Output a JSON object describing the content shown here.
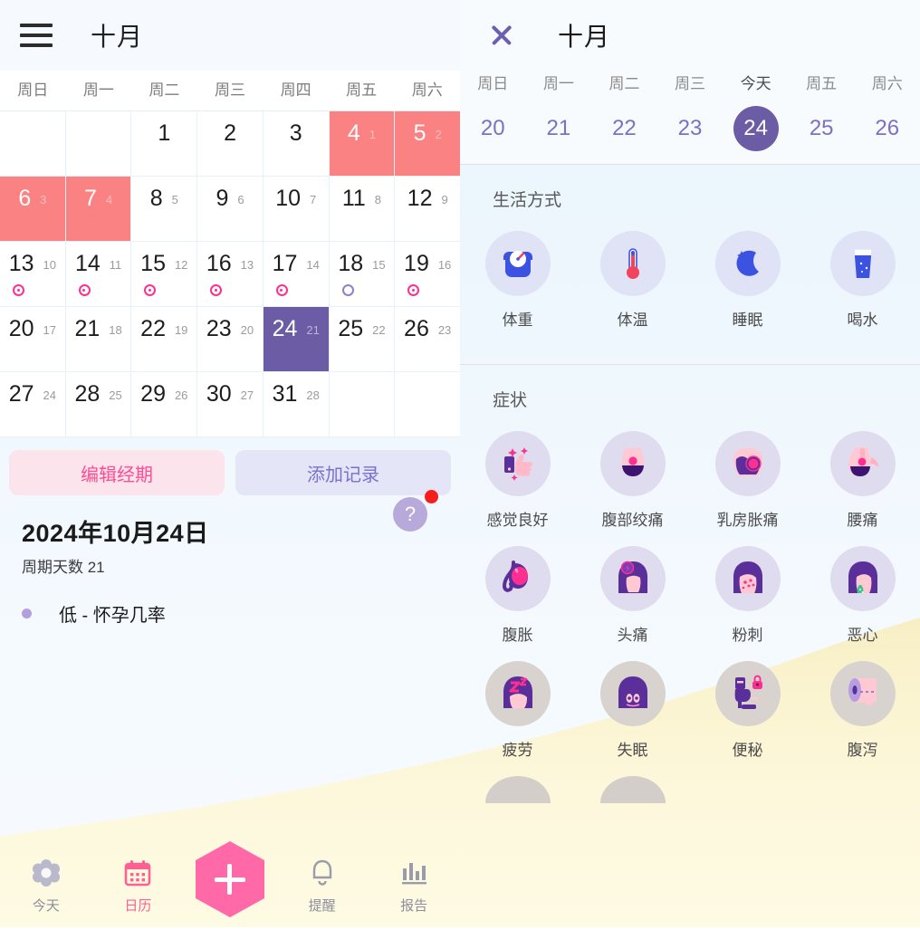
{
  "left": {
    "header": {
      "menu_icon": "hamburger-icon",
      "title": "十月"
    },
    "weekdays": [
      "周日",
      "周一",
      "周二",
      "周三",
      "周四",
      "周五",
      "周六"
    ],
    "calendar_rows": [
      [
        {
          "day": "",
          "sub": "",
          "type": "empty"
        },
        {
          "day": "",
          "sub": "",
          "type": "empty"
        },
        {
          "day": "1",
          "sub": "",
          "type": "normal"
        },
        {
          "day": "2",
          "sub": "",
          "type": "normal"
        },
        {
          "day": "3",
          "sub": "",
          "type": "normal"
        },
        {
          "day": "4",
          "sub": "1",
          "type": "period"
        },
        {
          "day": "5",
          "sub": "2",
          "type": "period"
        }
      ],
      [
        {
          "day": "6",
          "sub": "3",
          "type": "period"
        },
        {
          "day": "7",
          "sub": "4",
          "type": "period"
        },
        {
          "day": "8",
          "sub": "5",
          "type": "normal"
        },
        {
          "day": "9",
          "sub": "6",
          "type": "normal"
        },
        {
          "day": "10",
          "sub": "7",
          "type": "normal"
        },
        {
          "day": "11",
          "sub": "8",
          "type": "normal"
        },
        {
          "day": "12",
          "sub": "9",
          "type": "normal"
        }
      ],
      [
        {
          "day": "13",
          "sub": "10",
          "type": "normal",
          "marker": "fertile"
        },
        {
          "day": "14",
          "sub": "11",
          "type": "normal",
          "marker": "fertile"
        },
        {
          "day": "15",
          "sub": "12",
          "type": "normal",
          "marker": "fertile"
        },
        {
          "day": "16",
          "sub": "13",
          "type": "normal",
          "marker": "fertile"
        },
        {
          "day": "17",
          "sub": "14",
          "type": "normal",
          "marker": "fertile"
        },
        {
          "day": "18",
          "sub": "15",
          "type": "normal",
          "marker": "ovulation"
        },
        {
          "day": "19",
          "sub": "16",
          "type": "normal",
          "marker": "fertile"
        }
      ],
      [
        {
          "day": "20",
          "sub": "17",
          "type": "normal"
        },
        {
          "day": "21",
          "sub": "18",
          "type": "normal"
        },
        {
          "day": "22",
          "sub": "19",
          "type": "normal"
        },
        {
          "day": "23",
          "sub": "20",
          "type": "normal"
        },
        {
          "day": "24",
          "sub": "21",
          "type": "selected"
        },
        {
          "day": "25",
          "sub": "22",
          "type": "normal"
        },
        {
          "day": "26",
          "sub": "23",
          "type": "normal"
        }
      ],
      [
        {
          "day": "27",
          "sub": "24",
          "type": "normal"
        },
        {
          "day": "28",
          "sub": "25",
          "type": "normal"
        },
        {
          "day": "29",
          "sub": "26",
          "type": "normal"
        },
        {
          "day": "30",
          "sub": "27",
          "type": "normal"
        },
        {
          "day": "31",
          "sub": "28",
          "type": "normal"
        },
        {
          "day": "",
          "sub": "",
          "type": "empty"
        },
        {
          "day": "",
          "sub": "",
          "type": "empty"
        }
      ]
    ],
    "buttons": {
      "edit_period": "编辑经期",
      "add_record": "添加记录"
    },
    "info": {
      "date": "2024年10月24日",
      "cycle_days": "周期天数 21",
      "pregnancy_chance": "低 - 怀孕几率",
      "help_icon": "question-mark-icon",
      "help_label": "?"
    },
    "tabs": [
      {
        "label": "今天",
        "icon": "flower-icon",
        "active": false
      },
      {
        "label": "日历",
        "icon": "calendar-icon",
        "active": true
      },
      {
        "label": "",
        "icon": "plus-icon",
        "active": false
      },
      {
        "label": "提醒",
        "icon": "bell-icon",
        "active": false
      },
      {
        "label": "报告",
        "icon": "bar-chart-icon",
        "active": false
      }
    ]
  },
  "right": {
    "header": {
      "close_icon": "close-icon",
      "title": "十月"
    },
    "week": {
      "dows": [
        "周日",
        "周一",
        "周二",
        "周三",
        "今天",
        "周五",
        "周六"
      ],
      "days": [
        "20",
        "21",
        "22",
        "23",
        "24",
        "25",
        "26"
      ],
      "selected_index": 4
    },
    "sections": [
      {
        "title": "生活方式",
        "items": [
          {
            "label": "体重",
            "icon": "scale-icon",
            "bubble": "blue"
          },
          {
            "label": "体温",
            "icon": "thermometer-icon",
            "bubble": "blue"
          },
          {
            "label": "睡眠",
            "icon": "moon-icon",
            "bubble": "blue"
          },
          {
            "label": "喝水",
            "icon": "water-glass-icon",
            "bubble": "blue"
          }
        ]
      },
      {
        "title": "症状",
        "rows": [
          [
            {
              "label": "感觉良好",
              "icon": "thumbs-up-icon",
              "bubble": "lav"
            },
            {
              "label": "腹部绞痛",
              "icon": "abdominal-cramps-icon",
              "bubble": "lav"
            },
            {
              "label": "乳房胀痛",
              "icon": "breast-tenderness-icon",
              "bubble": "lav"
            },
            {
              "label": "腰痛",
              "icon": "back-pain-icon",
              "bubble": "lav"
            }
          ],
          [
            {
              "label": "腹胀",
              "icon": "bloating-icon",
              "bubble": "lav"
            },
            {
              "label": "头痛",
              "icon": "headache-icon",
              "bubble": "lav"
            },
            {
              "label": "粉刺",
              "icon": "acne-icon",
              "bubble": "lav"
            },
            {
              "label": "恶心",
              "icon": "nausea-icon",
              "bubble": "lav"
            }
          ],
          [
            {
              "label": "疲劳",
              "icon": "fatigue-icon",
              "bubble": "gray"
            },
            {
              "label": "失眠",
              "icon": "insomnia-icon",
              "bubble": "gray"
            },
            {
              "label": "便秘",
              "icon": "constipation-icon",
              "bubble": "gray"
            },
            {
              "label": "腹泻",
              "icon": "diarrhea-icon",
              "bubble": "gray"
            }
          ]
        ]
      }
    ]
  },
  "colors": {
    "period": "#fa8282",
    "selected": "#6b5ca5",
    "accent_pink": "#ff5f93",
    "accent_purple": "#7d6fd0",
    "fertile_dot": "#ff2f92",
    "ovulation_dot": "#8e7fd0",
    "sky": "#eaf4fd",
    "field": "#faf3cf"
  }
}
